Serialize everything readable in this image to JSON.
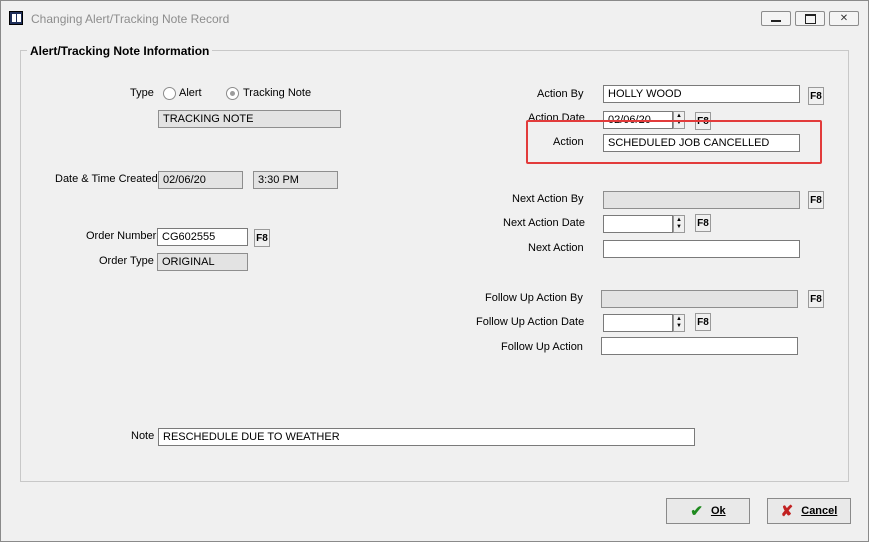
{
  "window": {
    "title": "Changing Alert/Tracking Note Record"
  },
  "group": {
    "title": "Alert/Tracking Note Information"
  },
  "type": {
    "label": "Type",
    "options": [
      {
        "label": "Alert",
        "selected": false
      },
      {
        "label": "Tracking Note",
        "selected": true
      }
    ],
    "value": "TRACKING NOTE"
  },
  "created": {
    "label": "Date & Time Created",
    "date": "02/06/20",
    "time": "3:30 PM"
  },
  "order": {
    "number_label": "Order Number",
    "number": "CG602555",
    "type_label": "Order Type",
    "type": "ORIGINAL"
  },
  "action": {
    "by_label": "Action By",
    "by": "HOLLY WOOD",
    "date_label": "Action Date",
    "date": "02/06/20",
    "action_label": "Action",
    "action": "SCHEDULED JOB CANCELLED"
  },
  "next_action": {
    "by_label": "Next Action By",
    "by": "",
    "date_label": "Next Action Date",
    "date": "",
    "action_label": "Next Action",
    "action": ""
  },
  "follow_up": {
    "by_label": "Follow Up Action By",
    "by": "",
    "date_label": "Follow Up Action Date",
    "date": "",
    "action_label": "Follow Up Action",
    "action": ""
  },
  "note": {
    "label": "Note",
    "value": "RESCHEDULE DUE TO WEATHER"
  },
  "buttons": {
    "f8": "F8",
    "ok": "Ok",
    "cancel": "Cancel"
  },
  "colors": {
    "highlight": "#e23b3b",
    "ok_icon": "#1f8a1f",
    "cancel_icon": "#c22222"
  }
}
